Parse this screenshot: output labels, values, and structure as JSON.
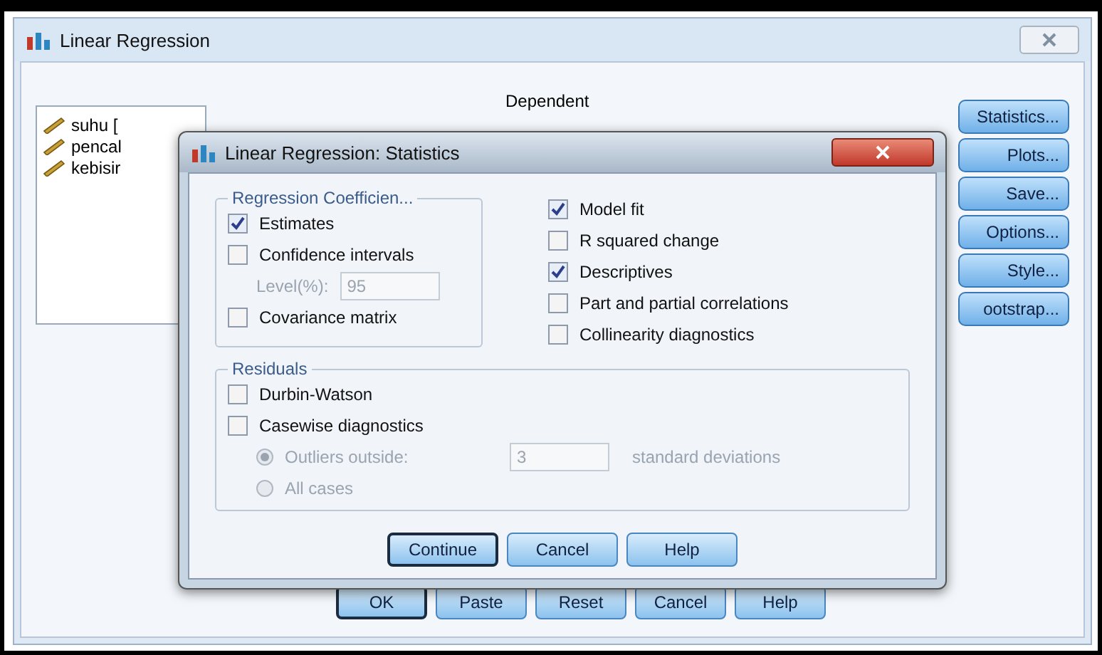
{
  "window": {
    "title": "Linear Regression"
  },
  "variables": [
    {
      "name": "suhu ["
    },
    {
      "name": "pencal"
    },
    {
      "name": "kebisir"
    }
  ],
  "dependent_label": "Dependent",
  "side_buttons": [
    {
      "label": "Statistics..."
    },
    {
      "label": "Plots..."
    },
    {
      "label": "Save..."
    },
    {
      "label": "Options..."
    },
    {
      "label": "Style..."
    },
    {
      "label": "ootstrap..."
    }
  ],
  "bottom_buttons": [
    {
      "label": "OK",
      "default": true
    },
    {
      "label": "Paste",
      "default": false
    },
    {
      "label": "Reset",
      "default": false
    },
    {
      "label": "Cancel",
      "default": false
    },
    {
      "label": "Help",
      "default": false
    }
  ],
  "dialog": {
    "title": "Linear Regression: Statistics",
    "coefficients": {
      "title": "Regression Coefficien...",
      "items": [
        {
          "kind": "checkbox",
          "label": "Estimates",
          "checked": true
        },
        {
          "kind": "checkbox",
          "label": "Confidence intervals",
          "checked": false
        },
        {
          "kind": "field",
          "label": "Level(%):",
          "value": "95",
          "disabled": true
        },
        {
          "kind": "checkbox",
          "label": "Covariance matrix",
          "checked": false
        }
      ]
    },
    "options": [
      {
        "label": "Model fit",
        "checked": true
      },
      {
        "label": "R squared change",
        "checked": false
      },
      {
        "label": "Descriptives",
        "checked": true
      },
      {
        "label": "Part and partial correlations",
        "checked": false
      },
      {
        "label": "Collinearity diagnostics",
        "checked": false
      }
    ],
    "residuals": {
      "title": "Residuals",
      "items": [
        {
          "kind": "checkbox",
          "label": "Durbin-Watson",
          "checked": false
        },
        {
          "kind": "checkbox",
          "label": "Casewise diagnostics",
          "checked": false
        },
        {
          "kind": "radio",
          "label": "Outliers outside:",
          "selected": true,
          "disabled": true,
          "value": "3",
          "suffix": "standard deviations"
        },
        {
          "kind": "radio",
          "label": "All cases",
          "selected": false,
          "disabled": true
        }
      ]
    },
    "buttons": [
      {
        "label": "Continue",
        "default": true
      },
      {
        "label": "Cancel",
        "default": false
      },
      {
        "label": "Help",
        "default": false
      }
    ]
  }
}
